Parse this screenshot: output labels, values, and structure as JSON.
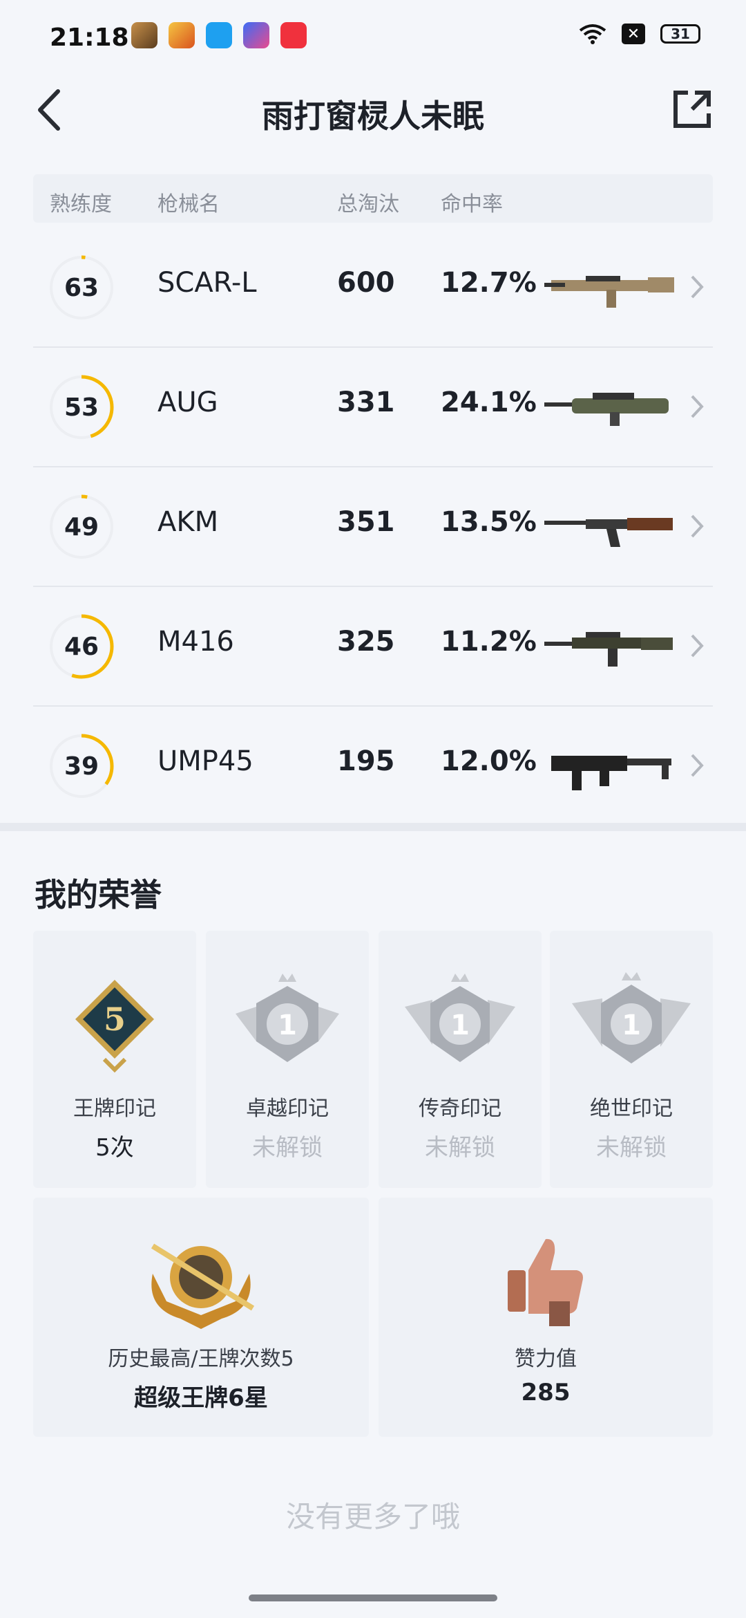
{
  "status": {
    "time": "21:18",
    "battery": "31",
    "apps": [
      "game-app-icon",
      "game-center-icon",
      "qq-icon",
      "star-app-icon",
      "music-app-icon"
    ]
  },
  "header": {
    "title": "雨打窗棂人未眠"
  },
  "table": {
    "headers": [
      "熟练度",
      "枪械名",
      "总淘汰",
      "命中率"
    ],
    "rows": [
      {
        "level": "63",
        "progress": 0.02,
        "name": "SCAR-L",
        "kills": "600",
        "rate": "12.7%",
        "gun": "scar-l-image"
      },
      {
        "level": "53",
        "progress": 0.45,
        "name": "AUG",
        "kills": "331",
        "rate": "24.1%",
        "gun": "aug-image"
      },
      {
        "level": "49",
        "progress": 0.03,
        "name": "AKM",
        "kills": "351",
        "rate": "13.5%",
        "gun": "akm-image"
      },
      {
        "level": "46",
        "progress": 0.55,
        "name": "M416",
        "kills": "325",
        "rate": "11.2%",
        "gun": "m416-image"
      },
      {
        "level": "39",
        "progress": 0.35,
        "name": "UMP45",
        "kills": "195",
        "rate": "12.0%",
        "gun": "ump45-image"
      }
    ]
  },
  "honors": {
    "title": "我的荣誉",
    "badges": [
      {
        "label": "王牌印记",
        "value": "5次",
        "badge_number": "5"
      },
      {
        "label": "卓越印记",
        "value": "未解锁",
        "badge_number": "1"
      },
      {
        "label": "传奇印记",
        "value": "未解锁",
        "badge_number": "1"
      },
      {
        "label": "绝世印记",
        "value": "未解锁",
        "badge_number": "1"
      }
    ],
    "rank": {
      "label": "历史最高/王牌次数5",
      "value": "超级王牌6星"
    },
    "likes": {
      "label": "赞力值",
      "value": "285"
    }
  },
  "footer": {
    "no_more": "没有更多了哦"
  },
  "colors": {
    "accent": "#f5b800",
    "ring_track": "#eceef2"
  }
}
